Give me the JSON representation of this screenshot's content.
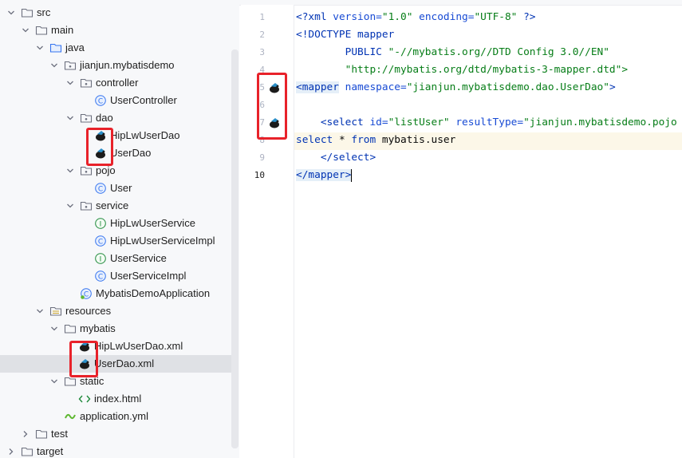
{
  "tree": {
    "items": [
      {
        "label": "src",
        "icon": "folder-icon",
        "name": "tree-item-src"
      },
      {
        "label": "main",
        "icon": "folder-icon",
        "name": "tree-item-main"
      },
      {
        "label": "java",
        "icon": "source-folder-icon",
        "name": "tree-item-java"
      },
      {
        "label": "jianjun.mybatisdemo",
        "icon": "package-icon",
        "name": "tree-item-package"
      },
      {
        "label": "controller",
        "icon": "package-icon",
        "name": "tree-item-controller"
      },
      {
        "label": "UserController",
        "icon": "class-icon",
        "name": "tree-item-usercontroller"
      },
      {
        "label": "dao",
        "icon": "package-icon",
        "name": "tree-item-dao"
      },
      {
        "label": "HipLwUserDao",
        "icon": "mybatis-bird-icon",
        "name": "tree-item-hiplwuserdao"
      },
      {
        "label": "UserDao",
        "icon": "mybatis-bird-icon",
        "name": "tree-item-userdao"
      },
      {
        "label": "pojo",
        "icon": "package-icon",
        "name": "tree-item-pojo"
      },
      {
        "label": "User",
        "icon": "class-icon",
        "name": "tree-item-user"
      },
      {
        "label": "service",
        "icon": "package-icon",
        "name": "tree-item-service"
      },
      {
        "label": "HipLwUserService",
        "icon": "interface-icon",
        "name": "tree-item-hiplwuserservice"
      },
      {
        "label": "HipLwUserServiceImpl",
        "icon": "class-icon",
        "name": "tree-item-hiplwuserserviceimpl"
      },
      {
        "label": "UserService",
        "icon": "interface-icon",
        "name": "tree-item-userservice"
      },
      {
        "label": "UserServiceImpl",
        "icon": "class-icon",
        "name": "tree-item-userserviceimpl"
      },
      {
        "label": "MybatisDemoApplication",
        "icon": "spring-class-icon",
        "name": "tree-item-mybatisdemoapplication"
      },
      {
        "label": "resources",
        "icon": "resources-folder-icon",
        "name": "tree-item-resources"
      },
      {
        "label": "mybatis",
        "icon": "folder-icon",
        "name": "tree-item-mybatis"
      },
      {
        "label": "HipLwUserDao.xml",
        "icon": "mybatis-bird-icon",
        "name": "tree-item-hiplwuserdao-xml"
      },
      {
        "label": "UserDao.xml",
        "icon": "mybatis-bird-icon",
        "name": "tree-item-userdao-xml"
      },
      {
        "label": "static",
        "icon": "folder-icon",
        "name": "tree-item-static"
      },
      {
        "label": "index.html",
        "icon": "html-icon",
        "name": "tree-item-index-html"
      },
      {
        "label": "application.yml",
        "icon": "yaml-icon",
        "name": "tree-item-application-yml"
      },
      {
        "label": "test",
        "icon": "folder-icon",
        "name": "tree-item-test"
      },
      {
        "label": "target",
        "icon": "folder-icon",
        "name": "tree-item-target"
      }
    ]
  },
  "editor": {
    "line_numbers": [
      "1",
      "2",
      "3",
      "4",
      "5",
      "6",
      "7",
      "8",
      "9",
      "10"
    ],
    "lines": {
      "l1_a": "<?xml ",
      "l1_b": "version=",
      "l1_c": "\"1.0\"",
      "l1_d": " encoding=",
      "l1_e": "\"UTF-8\"",
      "l1_f": " ?>",
      "l2": "<!DOCTYPE mapper",
      "l3_a": "        PUBLIC ",
      "l3_b": "\"-//mybatis.org//DTD Config 3.0//EN\"",
      "l4": "        \"http://mybatis.org/dtd/mybatis-3-mapper.dtd\">",
      "l5_a": "<mapper",
      "l5_b": " namespace=",
      "l5_c": "\"jianjun.mybatisdemo.dao.UserDao\"",
      "l5_d": ">",
      "l7_a": "    <select ",
      "l7_b": "id=",
      "l7_c": "\"listUser\"",
      "l7_d": " resultType=",
      "l7_e": "\"jianjun.mybatisdemo.pojo",
      "l8_a": "select",
      "l8_b": " * ",
      "l8_c": "from",
      "l8_d": " mybatis.user",
      "l9": "    </select>",
      "l10_a": "</mapper",
      "l10_b": ">"
    }
  },
  "colors": {
    "highlight_box": "#e8222a",
    "tree_bg": "#f7f8fa",
    "selected_row": "#dfe1e5"
  }
}
